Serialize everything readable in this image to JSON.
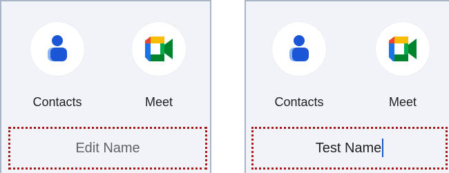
{
  "left_panel": {
    "apps": [
      {
        "label": "Contacts",
        "icon": "contacts-icon"
      },
      {
        "label": "Meet",
        "icon": "meet-icon"
      }
    ],
    "name_field": {
      "placeholder": "Edit Name"
    }
  },
  "right_panel": {
    "apps": [
      {
        "label": "Contacts",
        "icon": "contacts-icon"
      },
      {
        "label": "Meet",
        "icon": "meet-icon"
      }
    ],
    "name_field": {
      "value": "Test Name"
    }
  },
  "colors": {
    "panel_bg": "#f2f3f9",
    "panel_border": "#a9b4c6",
    "highlight_border": "#a3191b",
    "caret": "#1a56c8",
    "contacts_dark": "#1a56d6",
    "contacts_light": "#8ab4f8",
    "meet_green": "#00832d",
    "meet_blue": "#1a73e8",
    "meet_yellow": "#fbbc04",
    "meet_red": "#ea4335"
  }
}
